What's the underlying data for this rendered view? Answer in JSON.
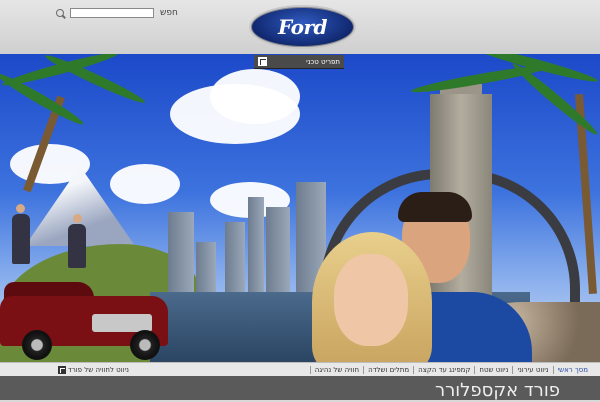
{
  "header": {
    "search_label": "חפש",
    "search_value": "",
    "logo_text": "Ford",
    "tech_button_label": "תפריט טכני"
  },
  "nav": {
    "items": [
      {
        "label": "מסך ראשי",
        "active": true
      },
      {
        "label": "ניווט עירוני",
        "active": false
      },
      {
        "label": "ניווט שטח",
        "active": false
      },
      {
        "label": "קמפינג עד הקצה",
        "active": false
      },
      {
        "label": "מתלים ושלדה",
        "active": false
      },
      {
        "label": "חוויה של נהיגה",
        "active": false
      }
    ],
    "left_item": "ניווט לחוויה של פורד"
  },
  "footer": {
    "title": "פורד אקספלורר"
  }
}
